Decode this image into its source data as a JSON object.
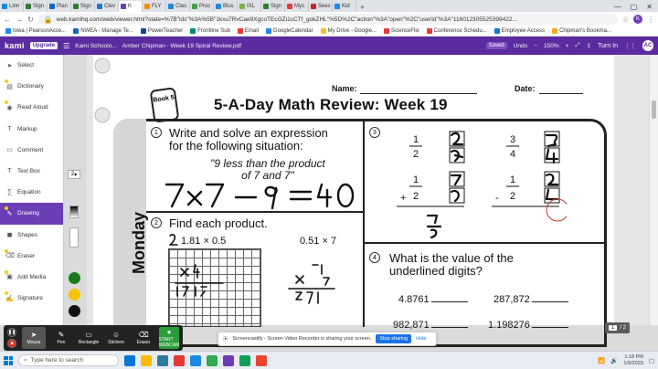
{
  "browser": {
    "tabs": [
      {
        "label": "Linn",
        "color": "#1e88e5",
        "active": false
      },
      {
        "label": "Sign",
        "color": "#2e7d32",
        "active": false
      },
      {
        "label": "Plan",
        "color": "#1565c0",
        "active": false
      },
      {
        "label": "Sign",
        "color": "#2e7d32",
        "active": false
      },
      {
        "label": "Clev",
        "color": "#1976d2",
        "active": false
      },
      {
        "label": "K",
        "color": "#6a3fb5",
        "active": true
      },
      {
        "label": "FLY",
        "color": "#fb8c00",
        "active": false
      },
      {
        "label": "Clas",
        "color": "#1e88e5",
        "active": false
      },
      {
        "label": "Proc",
        "color": "#43a047",
        "active": false
      },
      {
        "label": "Blus",
        "color": "#1e88e5",
        "active": false
      },
      {
        "label": "IXL",
        "color": "#7cb342",
        "active": false
      },
      {
        "label": "Sign",
        "color": "#2e7d32",
        "active": false
      },
      {
        "label": "Mys",
        "color": "#e53935",
        "active": false
      },
      {
        "label": "Sees",
        "color": "#c62828",
        "active": false
      },
      {
        "label": "Kid",
        "color": "#1e88e5",
        "active": false
      }
    ],
    "url": "web.kamihq.com/web/viewer.html?state=%7B\"ids\"%3A%5B\"1kxu7RvCae9XgcoTEcGZi1cCTf_gokZHL\"%5D%2C\"action\"%3A\"open\"%2C\"userId\"%3A\"116012305525399422...",
    "profile_initial": "K"
  },
  "bookmarks": [
    {
      "label": "Iowa | PearsonAcce...",
      "color": "#1e88e5"
    },
    {
      "label": "NWEA - Manage Te...",
      "color": "#1565c0"
    },
    {
      "label": "PowerTeacher",
      "color": "#0d47a1"
    },
    {
      "label": "Frontline Sub",
      "color": "#00897b"
    },
    {
      "label": "Email",
      "color": "#e53935"
    },
    {
      "label": "GoogleCalendar",
      "color": "#1e88e5"
    },
    {
      "label": "My Drive - Google...",
      "color": "#fbc02d"
    },
    {
      "label": "ScienceFlix",
      "color": "#e53935"
    },
    {
      "label": "Conference Schedu...",
      "color": "#e53935"
    },
    {
      "label": "Employee Access",
      "color": "#1976d2"
    },
    {
      "label": "Chipman's Bookma...",
      "color": "#f9a825"
    }
  ],
  "kami": {
    "logo": "kami",
    "upgrade_label": "Upgrade",
    "menu_glyph": "☰",
    "breadcrumb": "Kami Schoolo...",
    "file_name": "Amber Chipman - Week 19 Spiral Review.pdf",
    "saved_label": "Saved",
    "undo_label": "Undo",
    "zoom": "150%",
    "turn_in": "Turn In",
    "avatar": "AC"
  },
  "tools": [
    {
      "label": "Select",
      "icon": "➤",
      "active": false
    },
    {
      "label": "Dictionary",
      "icon": "▤",
      "active": false
    },
    {
      "label": "Read Aloud",
      "icon": "◉",
      "active": false
    },
    {
      "label": "Markup",
      "icon": "T",
      "active": false
    },
    {
      "label": "Comment",
      "icon": "▭",
      "active": false
    },
    {
      "label": "Text Box",
      "icon": "T",
      "active": false
    },
    {
      "label": "Equation",
      "icon": "∑",
      "active": false
    },
    {
      "label": "Drawing",
      "icon": "✎",
      "active": true
    },
    {
      "label": "Shapes",
      "icon": "◼",
      "active": false
    },
    {
      "label": "Eraser",
      "icon": "⌫",
      "active": false
    },
    {
      "label": "Add Media",
      "icon": "▣",
      "active": false
    },
    {
      "label": "Signature",
      "icon": "✍",
      "active": false
    }
  ],
  "drawing_options": {
    "size": "2",
    "colors": [
      "#1a7a1a",
      "#f4c400",
      "#111111"
    ]
  },
  "worksheet": {
    "name_label": "Name:",
    "date_label": "Date:",
    "title": "5-A-Day Math Review: Week 19",
    "book_badge": "Book 5",
    "day": "Monday",
    "q1": {
      "num": "1",
      "line1": "Write and solve an expression",
      "line2": "for the following situation:",
      "quote1": "\"9 less than the product",
      "quote2": "of 7 and 7\""
    },
    "q2": {
      "num": "2",
      "text": "Find each product.",
      "p1": "1.81 × 0.5",
      "p2": "0.51 × 7"
    },
    "q3": {
      "num": "3"
    },
    "q4": {
      "num": "4",
      "line1": "What is the value of the",
      "line2": "underlined digits?",
      "n1": "4.8761",
      "n2": "287,872",
      "n3": "982,871",
      "n4": "1.198276"
    }
  },
  "recorder": {
    "buttons": [
      {
        "label": "Mouse",
        "glyph": "➤",
        "active": true
      },
      {
        "label": "Pen",
        "glyph": "✎",
        "active": false
      },
      {
        "label": "Rectangle",
        "glyph": "▭",
        "active": false
      },
      {
        "label": "Stickers",
        "glyph": "☺",
        "active": false
      },
      {
        "label": "Eraser",
        "glyph": "⌫",
        "active": false
      }
    ],
    "webcam_label": "START WEBCAM"
  },
  "share_bar": {
    "message": "Screencastify - Screen Video Recorder is sharing your screen.",
    "stop_label": "Stop sharing",
    "hide_label": "Hide"
  },
  "page_counter": {
    "current": "1",
    "total": "/ 2"
  },
  "taskbar": {
    "search_placeholder": "Type here to search",
    "apps": [
      "#0078d4",
      "#ffb900",
      "#2d7d9a",
      "#e53935",
      "#1e88e5",
      "#34a853",
      "#6a3fb5",
      "#0f9d58",
      "#ea4335"
    ],
    "time": "1:18 PM",
    "date": "1/9/2023"
  }
}
